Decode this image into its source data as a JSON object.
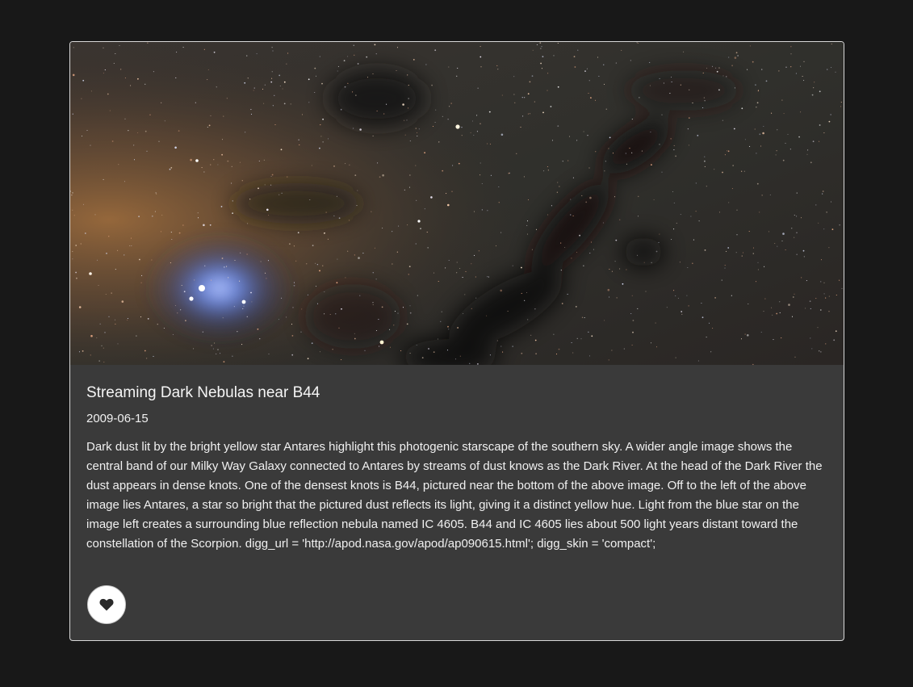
{
  "card": {
    "title": "Streaming Dark Nebulas near B44",
    "date": "2009-06-15",
    "description": "Dark dust lit by the bright yellow star Antares highlight this photogenic starscape of the southern sky. A wider angle image shows the central band of our Milky Way Galaxy connected to Antares by streams of dust knows as the Dark River. At the head of the Dark River the dust appears in dense knots. One of the densest knots is B44, pictured near the bottom of the above image. Off to the left of the above image lies Antares, a star so bright that the pictured dust reflects its light, giving it a distinct yellow hue. Light from the blue star on the image left creates a surrounding blue reflection nebula named IC 4605. B44 and IC 4605 lies about 500 light years distant toward the constellation of the Scorpion. digg_url = 'http://apod.nasa.gov/apod/ap090615.html'; digg_skin = 'compact';",
    "like_icon": "heart-icon"
  },
  "colors": {
    "page_background": "#181818",
    "card_background": "#3a3a3a",
    "text": "#f0f0f0",
    "like_button": "#ffffff",
    "heart": "#2a2a2a"
  }
}
